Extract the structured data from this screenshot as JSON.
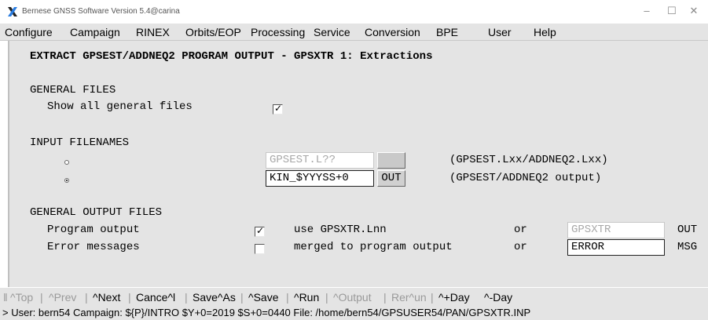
{
  "window": {
    "title": "Bernese GNSS Software Version 5.4@carina",
    "controls": {
      "minimize": "–",
      "maximize": "☐",
      "close": "✕"
    }
  },
  "menu": [
    "Configure",
    "Campaign",
    "RINEX",
    "Orbits/EOP",
    "Processing",
    "Service",
    "Conversion",
    "BPE",
    "User",
    "Help"
  ],
  "panel": {
    "heading": "EXTRACT GPSEST/ADDNEQ2 PROGRAM OUTPUT - GPSXTR 1: Extractions",
    "general_files": {
      "title": "GENERAL FILES",
      "show_all_label": "Show all general files",
      "show_all_checked": true
    },
    "input_filenames": {
      "title": "INPUT FILENAMES",
      "row1": {
        "selected": false,
        "value": "GPSEST.L??",
        "button": "",
        "desc": "(GPSEST.Lxx/ADDNEQ2.Lxx)"
      },
      "row2": {
        "selected": true,
        "value": "KIN_$YYYSS+0",
        "button": "OUT",
        "desc": "(GPSEST/ADDNEQ2 output)"
      }
    },
    "output_files": {
      "title": "GENERAL OUTPUT FILES",
      "program_output": {
        "label": "Program output",
        "checked": true,
        "desc": "use GPSXTR.Lnn",
        "or": "or",
        "value": "GPSXTR",
        "ext": "OUT"
      },
      "error_messages": {
        "label": "Error messages",
        "checked": false,
        "desc": "merged to program output",
        "or": "or",
        "value": "ERROR",
        "ext": "MSG"
      }
    }
  },
  "toolbar": {
    "top": "^Top",
    "prev": "^Prev",
    "next": "^Next",
    "cancel": "Cance^l",
    "save_as": "Save^As",
    "save": "^Save",
    "run": "^Run",
    "output": "^Output",
    "rerun": "Rer^un",
    "plus_day": "^+Day",
    "minus_day": "^-Day"
  },
  "status": "> User: bern54  Campaign: ${P}/INTRO  $Y+0=2019  $S+0=0440  File: /home/bern54/GPSUSER54/PAN/GPSXTR.INP"
}
